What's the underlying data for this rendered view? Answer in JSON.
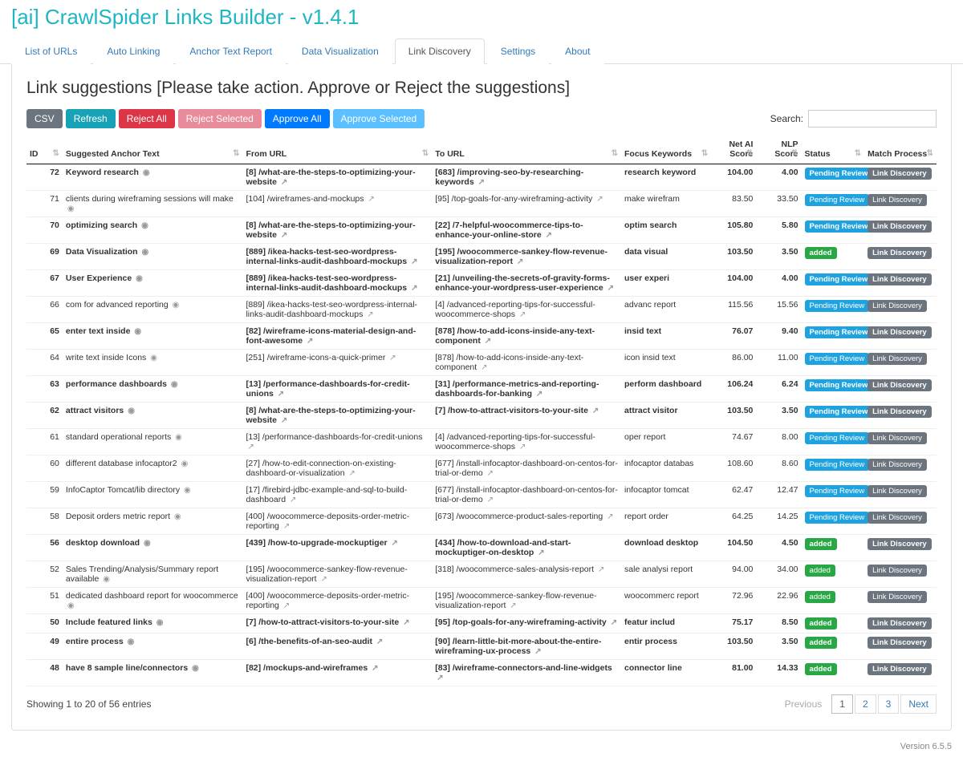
{
  "app_title": "[ai] CrawlSpider Links Builder - v1.4.1",
  "tabs": [
    "List of URLs",
    "Auto Linking",
    "Anchor Text Report",
    "Data Visualization",
    "Link Discovery",
    "Settings",
    "About"
  ],
  "active_tab": 4,
  "panel_title": "Link suggestions [Please take action. Approve or Reject the suggestions]",
  "toolbar": {
    "csv": "CSV",
    "refresh": "Refresh",
    "reject_all": "Reject All",
    "reject_sel": "Reject Selected",
    "approve_all": "Approve All",
    "approve_sel": "Approve Selected"
  },
  "search_label": "Search:",
  "columns": [
    "ID",
    "Suggested Anchor Text",
    "From URL",
    "To URL",
    "Focus Keywords",
    "Net AI Score",
    "NLP Score",
    "Status",
    "Match Process"
  ],
  "rows": [
    {
      "id": 72,
      "bold": true,
      "anchor": "Keyword research",
      "from": "[8] /what-are-the-steps-to-optimizing-your-website",
      "to": "[683] /improving-seo-by-researching-keywords",
      "focus": "research keyword",
      "net": "104.00",
      "nlp": "4.00",
      "status": "Pending Review",
      "proc": "Link Discovery"
    },
    {
      "id": 71,
      "bold": false,
      "anchor": "clients during wireframing sessions will make",
      "from": "[104] /wireframes-and-mockups",
      "to": "[95] /top-goals-for-any-wireframing-activity",
      "focus": "make wirefram",
      "net": "83.50",
      "nlp": "33.50",
      "status": "Pending Review",
      "proc": "Link Discovery"
    },
    {
      "id": 70,
      "bold": true,
      "anchor": "optimizing search",
      "from": "[8] /what-are-the-steps-to-optimizing-your-website",
      "to": "[22] /7-helpful-woocommerce-tips-to-enhance-your-online-store",
      "focus": "optim search",
      "net": "105.80",
      "nlp": "5.80",
      "status": "Pending Review",
      "proc": "Link Discovery"
    },
    {
      "id": 69,
      "bold": true,
      "anchor": "Data Visualization",
      "from": "[889] /ikea-hacks-test-seo-wordpress-internal-links-audit-dashboard-mockups",
      "to": "[195] /woocommerce-sankey-flow-revenue-visualization-report",
      "focus": "data visual",
      "net": "103.50",
      "nlp": "3.50",
      "status": "added",
      "proc": "Link Discovery"
    },
    {
      "id": 67,
      "bold": true,
      "anchor": "User Experience",
      "from": "[889] /ikea-hacks-test-seo-wordpress-internal-links-audit-dashboard-mockups",
      "to": "[21] /unveiling-the-secrets-of-gravity-forms-enhance-your-wordpress-user-experience",
      "focus": "user experi",
      "net": "104.00",
      "nlp": "4.00",
      "status": "Pending Review",
      "proc": "Link Discovery"
    },
    {
      "id": 66,
      "bold": false,
      "anchor": "com for advanced reporting",
      "from": "[889] /ikea-hacks-test-seo-wordpress-internal-links-audit-dashboard-mockups",
      "to": "[4] /advanced-reporting-tips-for-successful-woocommerce-shops",
      "focus": "advanc report",
      "net": "115.56",
      "nlp": "15.56",
      "status": "Pending Review",
      "proc": "Link Discovery"
    },
    {
      "id": 65,
      "bold": true,
      "anchor": "enter text inside",
      "from": "[82] /wireframe-icons-material-design-and-font-awesome",
      "to": "[878] /how-to-add-icons-inside-any-text-component",
      "focus": "insid text",
      "net": "76.07",
      "nlp": "9.40",
      "status": "Pending Review",
      "proc": "Link Discovery"
    },
    {
      "id": 64,
      "bold": false,
      "anchor": "write text inside Icons",
      "from": "[251] /wireframe-icons-a-quick-primer",
      "to": "[878] /how-to-add-icons-inside-any-text-component",
      "focus": "icon insid text",
      "net": "86.00",
      "nlp": "11.00",
      "status": "Pending Review",
      "proc": "Link Discovery"
    },
    {
      "id": 63,
      "bold": true,
      "anchor": "performance dashboards",
      "from": "[13] /performance-dashboards-for-credit-unions",
      "to": "[31] /performance-metrics-and-reporting-dashboards-for-banking",
      "focus": "perform dashboard",
      "net": "106.24",
      "nlp": "6.24",
      "status": "Pending Review",
      "proc": "Link Discovery"
    },
    {
      "id": 62,
      "bold": true,
      "anchor": "attract visitors",
      "from": "[8] /what-are-the-steps-to-optimizing-your-website",
      "to": "[7] /how-to-attract-visitors-to-your-site",
      "focus": "attract visitor",
      "net": "103.50",
      "nlp": "3.50",
      "status": "Pending Review",
      "proc": "Link Discovery"
    },
    {
      "id": 61,
      "bold": false,
      "anchor": "standard operational reports",
      "from": "[13] /performance-dashboards-for-credit-unions",
      "to": "[4] /advanced-reporting-tips-for-successful-woocommerce-shops",
      "focus": "oper report",
      "net": "74.67",
      "nlp": "8.00",
      "status": "Pending Review",
      "proc": "Link Discovery"
    },
    {
      "id": 60,
      "bold": false,
      "anchor": "different database infocaptor2",
      "from": "[27] /how-to-edit-connection-on-existing-dashboard-or-visualization",
      "to": "[677] /install-infocaptor-dashboard-on-centos-for-trial-or-demo",
      "focus": "infocaptor databas",
      "net": "108.60",
      "nlp": "8.60",
      "status": "Pending Review",
      "proc": "Link Discovery"
    },
    {
      "id": 59,
      "bold": false,
      "anchor": "InfoCaptor Tomcat/lib directory",
      "from": "[17] /firebird-jdbc-example-and-sql-to-build-dashboard",
      "to": "[677] /install-infocaptor-dashboard-on-centos-for-trial-or-demo",
      "focus": "infocaptor tomcat",
      "net": "62.47",
      "nlp": "12.47",
      "status": "Pending Review",
      "proc": "Link Discovery"
    },
    {
      "id": 58,
      "bold": false,
      "anchor": "Deposit orders metric report",
      "from": "[400] /woocommerce-deposits-order-metric-reporting",
      "to": "[673] /woocommerce-product-sales-reporting",
      "focus": "report order",
      "net": "64.25",
      "nlp": "14.25",
      "status": "Pending Review",
      "proc": "Link Discovery"
    },
    {
      "id": 56,
      "bold": true,
      "anchor": "desktop download",
      "from": "[439] /how-to-upgrade-mockuptiger",
      "to": "[434] /how-to-download-and-start-mockuptiger-on-desktop",
      "focus": "download desktop",
      "net": "104.50",
      "nlp": "4.50",
      "status": "added",
      "proc": "Link Discovery"
    },
    {
      "id": 52,
      "bold": false,
      "anchor": "Sales Trending/Analysis/Summary report available",
      "from": "[195] /woocommerce-sankey-flow-revenue-visualization-report",
      "to": "[318] /woocommerce-sales-analysis-report",
      "focus": "sale analysi report",
      "net": "94.00",
      "nlp": "34.00",
      "status": "added",
      "proc": "Link Discovery"
    },
    {
      "id": 51,
      "bold": false,
      "anchor": "dedicated dashboard report for woocommerce",
      "from": "[400] /woocommerce-deposits-order-metric-reporting",
      "to": "[195] /woocommerce-sankey-flow-revenue-visualization-report",
      "focus": "woocommerc report",
      "net": "72.96",
      "nlp": "22.96",
      "status": "added",
      "proc": "Link Discovery"
    },
    {
      "id": 50,
      "bold": true,
      "anchor": "Include featured links",
      "from": "[7] /how-to-attract-visitors-to-your-site",
      "to": "[95] /top-goals-for-any-wireframing-activity",
      "focus": "featur includ",
      "net": "75.17",
      "nlp": "8.50",
      "status": "added",
      "proc": "Link Discovery"
    },
    {
      "id": 49,
      "bold": true,
      "anchor": "entire process",
      "from": "[6] /the-benefits-of-an-seo-audit",
      "to": "[90] /learn-little-bit-more-about-the-entire-wireframing-ux-process",
      "focus": "entir process",
      "net": "103.50",
      "nlp": "3.50",
      "status": "added",
      "proc": "Link Discovery"
    },
    {
      "id": 48,
      "bold": true,
      "anchor": "have 8 sample line/connectors",
      "from": "[82] /mockups-and-wireframes",
      "to": "[83] /wireframe-connectors-and-line-widgets",
      "focus": "connector line",
      "net": "81.00",
      "nlp": "14.33",
      "status": "added",
      "proc": "Link Discovery"
    }
  ],
  "footer_info": "Showing 1 to 20 of 56 entries",
  "pager": {
    "prev": "Previous",
    "pages": [
      "1",
      "2",
      "3"
    ],
    "next": "Next",
    "active": 0
  },
  "version": "Version 6.5.5"
}
